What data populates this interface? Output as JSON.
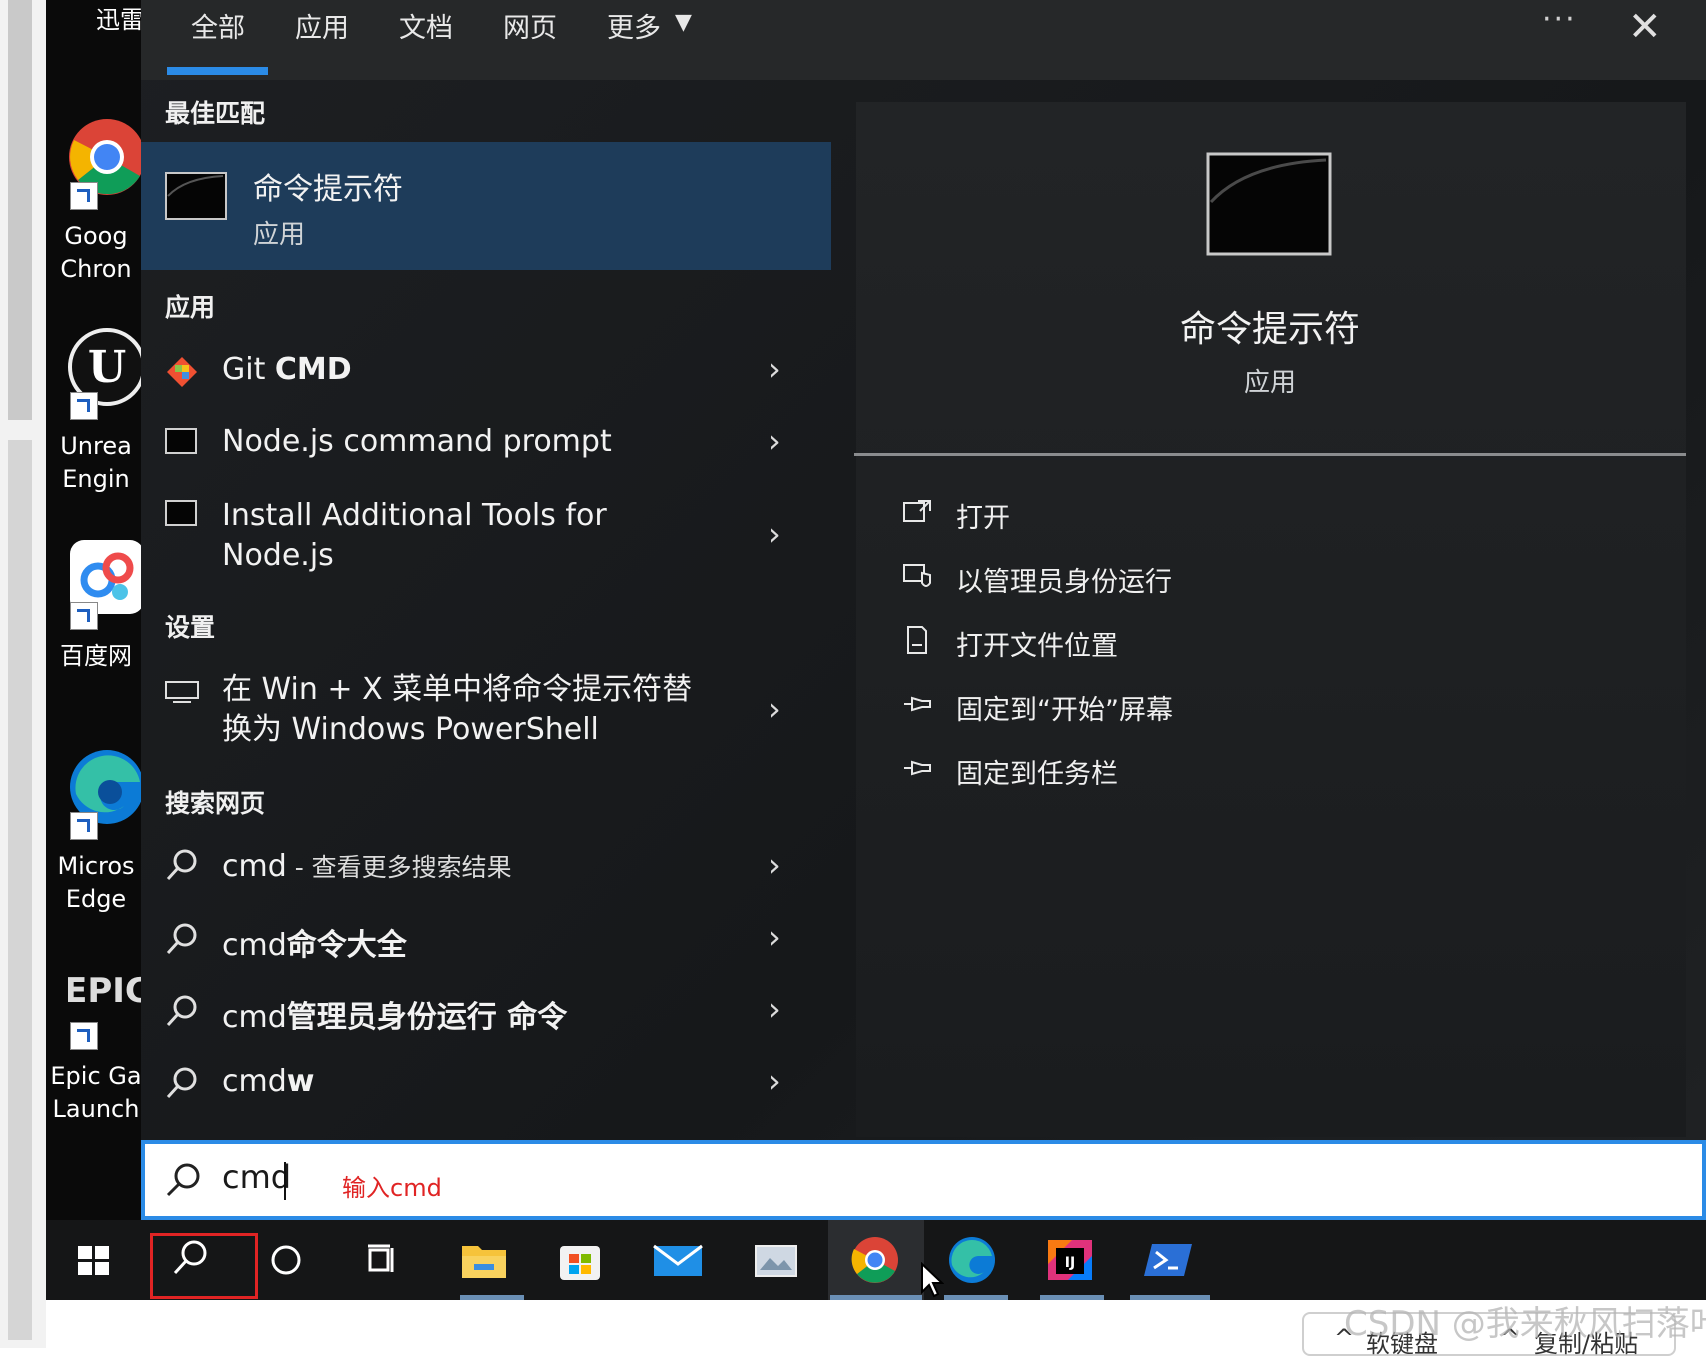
{
  "colors": {
    "accent": "#2b8be6",
    "selected_row": "#1e3c5a",
    "hint": "#e02424"
  },
  "desktop": {
    "top_label": "迅雷",
    "icons": [
      {
        "name": "google-chrome-icon",
        "label": "Goog\nChron"
      },
      {
        "name": "unreal-engine-icon",
        "label": "Unrea\nEngin"
      },
      {
        "name": "baidu-netdisk-icon",
        "label": "百度网"
      },
      {
        "name": "edge-icon",
        "label": "Micros\nEdge"
      },
      {
        "name": "epic-games-icon",
        "label": "Epic Ga\nLaunch",
        "logo_text": "EPIC"
      }
    ]
  },
  "tabs": [
    "全部",
    "应用",
    "文档",
    "网页",
    "更多"
  ],
  "sections": {
    "best_match": "最佳匹配",
    "apps": "应用",
    "settings": "设置",
    "web": "搜索网页"
  },
  "best_match": {
    "title": "命令提示符",
    "subtitle": "应用"
  },
  "apps": [
    {
      "prefix": "Git ",
      "bold": "CMD",
      "icon": "git-icon"
    },
    {
      "prefix": "Node.js command prompt",
      "bold": "",
      "icon": "console-icon"
    },
    {
      "prefix": "Install Additional Tools for\nNode.js",
      "bold": "",
      "icon": "console-icon"
    }
  ],
  "settings": [
    {
      "label": "在 Win + X 菜单中将命令提示符替\n换为 Windows PowerShell",
      "icon": "monitor-icon"
    }
  ],
  "web": [
    {
      "prefix": "cmd",
      "rest": " - 查看更多搜索结果",
      "bold_rest": false
    },
    {
      "prefix": "cmd",
      "rest": "命令大全",
      "bold_rest": true
    },
    {
      "prefix": "cmd",
      "rest": "管理员身份运行 命令",
      "bold_rest": true
    },
    {
      "prefix": "cmd",
      "rest": "w",
      "bold_rest": true
    }
  ],
  "detail": {
    "title": "命令提示符",
    "subtitle": "应用",
    "actions": [
      {
        "label": "打开",
        "icon": "open-icon"
      },
      {
        "label": "以管理员身份运行",
        "icon": "run-as-admin-icon"
      },
      {
        "label": "打开文件位置",
        "icon": "file-location-icon"
      },
      {
        "label": "固定到“开始”屏幕",
        "icon": "pin-icon"
      },
      {
        "label": "固定到任务栏",
        "icon": "pin-icon"
      }
    ]
  },
  "search": {
    "value": "cmd",
    "hint": "输入cmd"
  },
  "taskbar": [
    "windows-start-icon",
    "search-icon",
    "cortana-icon",
    "task-view-icon",
    "file-explorer-icon",
    "store-icon",
    "mail-icon",
    "photos-icon",
    "chrome-icon",
    "edge-icon",
    "intellij-icon",
    "powershell-icon"
  ],
  "ime": {
    "keyboard": "软键盘",
    "clipboard": "复制/粘贴"
  },
  "watermark": "CSDN @我来秋风扫落叶"
}
